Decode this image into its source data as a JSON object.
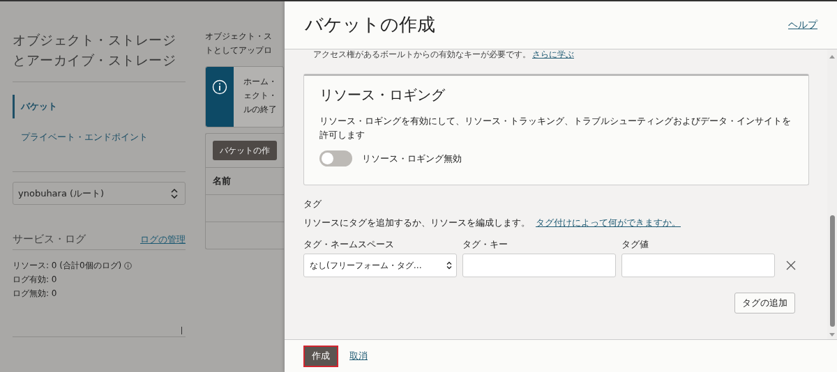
{
  "background_page": {
    "sidebar": {
      "title": "オブジェクト・ストレージとアーカイブ・ストレージ",
      "nav": [
        {
          "label": "バケット",
          "selected": true
        },
        {
          "label": "プライベート・エンドポイント",
          "selected": false
        }
      ],
      "compartment": "ynobuhara (ルート)",
      "service_logs": {
        "title": "サービス・ログ",
        "link": "ログの管理",
        "stats": [
          "リソース: 0 (合計0個のログ)",
          "ログ有効: 0",
          "ログ無効: 0"
        ]
      }
    },
    "main": {
      "intro_lines": [
        "オブジェクト・ス",
        "トとしてアップロ"
      ],
      "info_lines": [
        "ホーム・",
        "ェクト・",
        "ルの終了"
      ],
      "create_button": "バケットの作",
      "columns": [
        "名前"
      ]
    }
  },
  "drawer": {
    "title": "バケットの作成",
    "help": "ヘルプ",
    "note": "アクセス権があるボールトからの有効なキーが必要です。",
    "note_link": "さらに学ぶ",
    "logging": {
      "title": "リソース・ロギング",
      "description": "リソース・ロギングを有効にして、リソース・トラッキング、トラブルシューティングおよびデータ・インサイトを許可します",
      "toggle": {
        "on": false,
        "label": "リソース・ロギング無効"
      }
    },
    "tags": {
      "heading": "タグ",
      "description": "リソースにタグを追加するか、リソースを編成します。",
      "link": "タグ付けによって何ができますか。",
      "columns": [
        "タグ・ネームスペース",
        "タグ・キー",
        "タグ値"
      ],
      "namespace": "なし(フリーフォーム・タグ…",
      "add_button": "タグの追加"
    },
    "footer": {
      "primary": "作成",
      "cancel": "取消"
    }
  }
}
